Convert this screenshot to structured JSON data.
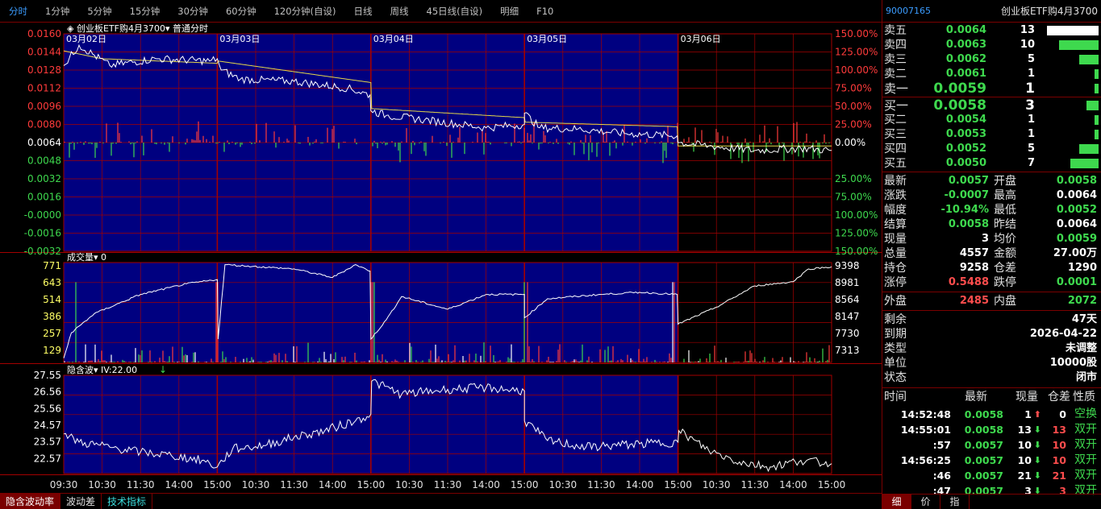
{
  "period_tabs": [
    {
      "label": "分时",
      "active": true
    },
    {
      "label": "1分钟"
    },
    {
      "label": "5分钟"
    },
    {
      "label": "15分钟"
    },
    {
      "label": "30分钟"
    },
    {
      "label": "60分钟"
    },
    {
      "label": "120分钟(自设)"
    },
    {
      "label": "日线"
    },
    {
      "label": "周线"
    },
    {
      "label": "45日线(自设)"
    },
    {
      "label": "明细"
    },
    {
      "label": "F10"
    }
  ],
  "chart_legend": {
    "title": "创业板ETF购4月3700",
    "mode": "普通分时",
    "vol_label": "成交量",
    "vol_value": "0",
    "iv_label": "隐含波",
    "iv_value": "IV:22.00"
  },
  "colors": {
    "grid": "#a30000",
    "panel_bg": "#000080",
    "up": "#ff3b3b",
    "down": "#3ed94e",
    "price_line": "#ffffff",
    "avg_line": "#e6d84a"
  },
  "chart_data": [
    {
      "type": "line",
      "title": "创业板ETF购4月3700 普通分时",
      "days": [
        "03月02日",
        "03月03日",
        "03月04日",
        "03月05日",
        "03月06日"
      ],
      "y_ticks": [
        "0.0160",
        "0.0144",
        "0.0128",
        "0.0112",
        "0.0096",
        "0.0080",
        "0.0064",
        "0.0048",
        "0.0032",
        "0.0016",
        "-0.0000",
        "-0.0016",
        "-0.0032"
      ],
      "pct_ticks": [
        "150.00%",
        "125.00%",
        "100.00%",
        "75.00%",
        "50.00%",
        "25.00%",
        "0.00%",
        "25.00%",
        "75.00%",
        "100.00%",
        "125.00%",
        "150.00%"
      ],
      "ylim": [
        -0.0032,
        0.016
      ],
      "series": [
        {
          "x": [
            0,
            0.02,
            0.06,
            0.12,
            0.19,
            0.2,
            0.205,
            0.23,
            0.3,
            0.37,
            0.399,
            0.4,
            0.42,
            0.47,
            0.55,
            0.6,
            0.6,
            0.62,
            0.67,
            0.73,
            0.799,
            0.8,
            0.84,
            0.9,
            0.96,
            1.0
          ],
          "y": [
            0.0132,
            0.015,
            0.0132,
            0.0138,
            0.0136,
            0.0138,
            0.0128,
            0.012,
            0.0118,
            0.0112,
            0.0106,
            0.0092,
            0.0088,
            0.0084,
            0.0077,
            0.008,
            0.009,
            0.0077,
            0.0076,
            0.0072,
            0.007,
            0.0064,
            0.0061,
            0.0057,
            0.0059,
            0.0057
          ]
        },
        {
          "x": [
            0,
            0.05,
            0.2,
            0.201,
            0.4,
            0.401,
            0.6,
            0.601,
            0.799,
            0.8,
            1.0
          ],
          "y": [
            0.0145,
            0.0138,
            0.0134,
            0.0136,
            0.0117,
            0.0094,
            0.0086,
            0.0082,
            0.0078,
            0.0061,
            0.0061
          ]
        }
      ]
    },
    {
      "type": "bar",
      "title": "成交量",
      "y_ticks": [
        "771",
        "643",
        "514",
        "386",
        "257",
        "129"
      ],
      "right_ticks": [
        "9398",
        "8981",
        "8564",
        "8147",
        "7730",
        "7313"
      ],
      "ylim": [
        0,
        771
      ],
      "oi_lim": [
        7100,
        9450
      ],
      "oi_line": {
        "x": [
          0,
          0.01,
          0.04,
          0.1,
          0.16,
          0.2,
          0.201,
          0.21,
          0.3,
          0.35,
          0.38,
          0.399,
          0.4,
          0.42,
          0.44,
          0.5,
          0.55,
          0.6,
          0.6,
          0.63,
          0.7,
          0.75,
          0.799,
          0.8,
          0.85,
          0.9,
          0.95,
          0.97,
          1.0
        ],
        "y": [
          7200,
          7800,
          8250,
          8700,
          8950,
          9050,
          7650,
          9400,
          9300,
          9100,
          9400,
          9250,
          7650,
          8100,
          8650,
          8350,
          8700,
          8700,
          8150,
          8600,
          8700,
          8750,
          8700,
          8000,
          8400,
          8900,
          9000,
          9300,
          9350
        ]
      }
    },
    {
      "type": "line",
      "title": "隐含波 IV:22.00",
      "y_ticks": [
        "27.55",
        "26.56",
        "25.56",
        "24.57",
        "23.57",
        "22.57"
      ],
      "ylim": [
        21.6,
        27.55
      ],
      "series": [
        {
          "x": [
            0,
            0.02,
            0.06,
            0.1,
            0.14,
            0.18,
            0.2,
            0.22,
            0.26,
            0.3,
            0.34,
            0.38,
            0.4,
            0.401,
            0.44,
            0.5,
            0.55,
            0.6,
            0.6,
            0.63,
            0.68,
            0.75,
            0.8,
            0.801,
            0.84,
            0.88,
            0.92,
            0.96,
            1.0
          ],
          "y": [
            24.0,
            23.5,
            23.2,
            22.9,
            22.7,
            22.4,
            22.0,
            23.1,
            23.3,
            23.8,
            24.2,
            24.8,
            25.2,
            27.2,
            26.4,
            26.7,
            26.8,
            26.6,
            24.8,
            23.6,
            23.2,
            23.4,
            23.5,
            24.2,
            23.0,
            22.3,
            22.0,
            22.4,
            22.2
          ]
        }
      ]
    }
  ],
  "time_axis": [
    "09:30",
    "10:30",
    "11:30",
    "14:00",
    "15:00",
    "10:30",
    "11:30",
    "14:00",
    "15:00",
    "10:30",
    "11:30",
    "14:00",
    "15:00",
    "10:30",
    "11:30",
    "14:00",
    "15:00",
    "10:30",
    "11:30",
    "14:00",
    "15:00"
  ],
  "bottom_tabs": [
    "隐含波动率",
    "波动差",
    "技术指标"
  ],
  "right": {
    "code": "90007165",
    "name": "创业板ETF购4月3700",
    "asks": [
      {
        "label": "卖五",
        "price": "0.0064",
        "vol": "13",
        "bar": 1.0,
        "bar_color": "#ffffff"
      },
      {
        "label": "卖四",
        "price": "0.0063",
        "vol": "10",
        "bar": 0.77,
        "bar_color": "#3ed94e"
      },
      {
        "label": "卖三",
        "price": "0.0062",
        "vol": "5",
        "bar": 0.38,
        "bar_color": "#3ed94e"
      },
      {
        "label": "卖二",
        "price": "0.0061",
        "vol": "1",
        "bar": 0.08,
        "bar_color": "#3ed94e"
      },
      {
        "label": "卖一",
        "price": "0.0059",
        "vol": "1",
        "bar": 0.08,
        "bar_color": "#3ed94e"
      }
    ],
    "bids": [
      {
        "label": "买一",
        "price": "0.0058",
        "vol": "3",
        "bar": 0.23,
        "bar_color": "#3ed94e"
      },
      {
        "label": "买二",
        "price": "0.0054",
        "vol": "1",
        "bar": 0.08,
        "bar_color": "#3ed94e"
      },
      {
        "label": "买三",
        "price": "0.0053",
        "vol": "1",
        "bar": 0.08,
        "bar_color": "#3ed94e"
      },
      {
        "label": "买四",
        "price": "0.0052",
        "vol": "5",
        "bar": 0.38,
        "bar_color": "#3ed94e"
      },
      {
        "label": "买五",
        "price": "0.0050",
        "vol": "7",
        "bar": 0.54,
        "bar_color": "#3ed94e"
      }
    ],
    "quotes": [
      {
        "k1": "最新",
        "v1": "0.0057",
        "c1": "green",
        "k2": "开盘",
        "v2": "0.0058",
        "c2": "green"
      },
      {
        "k1": "涨跌",
        "v1": "-0.0007",
        "c1": "green",
        "k2": "最高",
        "v2": "0.0064",
        "c2": "white"
      },
      {
        "k1": "幅度",
        "v1": "-10.94%",
        "c1": "green",
        "k2": "最低",
        "v2": "0.0052",
        "c2": "green"
      },
      {
        "k1": "结算",
        "v1": "0.0058",
        "c1": "green",
        "k2": "昨结",
        "v2": "0.0064",
        "c2": "white"
      },
      {
        "k1": "现量",
        "v1": "3",
        "c1": "white",
        "k2": "均价",
        "v2": "0.0059",
        "c2": "green"
      },
      {
        "k1": "总量",
        "v1": "4557",
        "c1": "white",
        "k2": "金额",
        "v2": "27.00万",
        "c2": "white"
      },
      {
        "k1": "持仓",
        "v1": "9258",
        "c1": "white",
        "k2": "仓差",
        "v2": "1290",
        "c2": "white"
      },
      {
        "k1": "涨停",
        "v1": "0.5488",
        "c1": "red",
        "k2": "跌停",
        "v2": "0.0001",
        "c2": "green"
      }
    ],
    "outer": {
      "k1": "外盘",
      "v1": "2485",
      "k2": "内盘",
      "v2": "2072"
    },
    "info": [
      {
        "k": "剩余",
        "v": "47天"
      },
      {
        "k": "到期",
        "v": "2026-04-22"
      },
      {
        "k": "类型",
        "v": "未调整"
      },
      {
        "k": "单位",
        "v": "10000股"
      },
      {
        "k": "状态",
        "v": "闭市"
      }
    ],
    "ticks_header": [
      "时间",
      "最新",
      "现量",
      "仓差",
      "性质"
    ],
    "ticks": [
      {
        "time": "14:52:48",
        "price": "0.0058",
        "vol": "1",
        "arrow": "up",
        "oi": "0",
        "oi_color": "white",
        "nature": "空换",
        "nature_color": "green"
      },
      {
        "time": "14:55:01",
        "price": "0.0058",
        "vol": "13",
        "arrow": "down",
        "oi": "13",
        "oi_color": "red",
        "nature": "双开",
        "nature_color": "green"
      },
      {
        "time": ":57",
        "price": "0.0057",
        "vol": "10",
        "arrow": "down",
        "oi": "10",
        "oi_color": "red",
        "nature": "双开",
        "nature_color": "green"
      },
      {
        "time": "14:56:25",
        "price": "0.0057",
        "vol": "10",
        "arrow": "down",
        "oi": "10",
        "oi_color": "red",
        "nature": "双开",
        "nature_color": "green"
      },
      {
        "time": ":46",
        "price": "0.0057",
        "vol": "21",
        "arrow": "down",
        "oi": "21",
        "oi_color": "red",
        "nature": "双开",
        "nature_color": "green"
      },
      {
        "time": ":47",
        "price": "0.0057",
        "vol": "3",
        "arrow": "down",
        "oi": "3",
        "oi_color": "red",
        "nature": "双开",
        "nature_color": "green"
      }
    ],
    "side_tabs": [
      "细",
      "价",
      "指"
    ]
  }
}
